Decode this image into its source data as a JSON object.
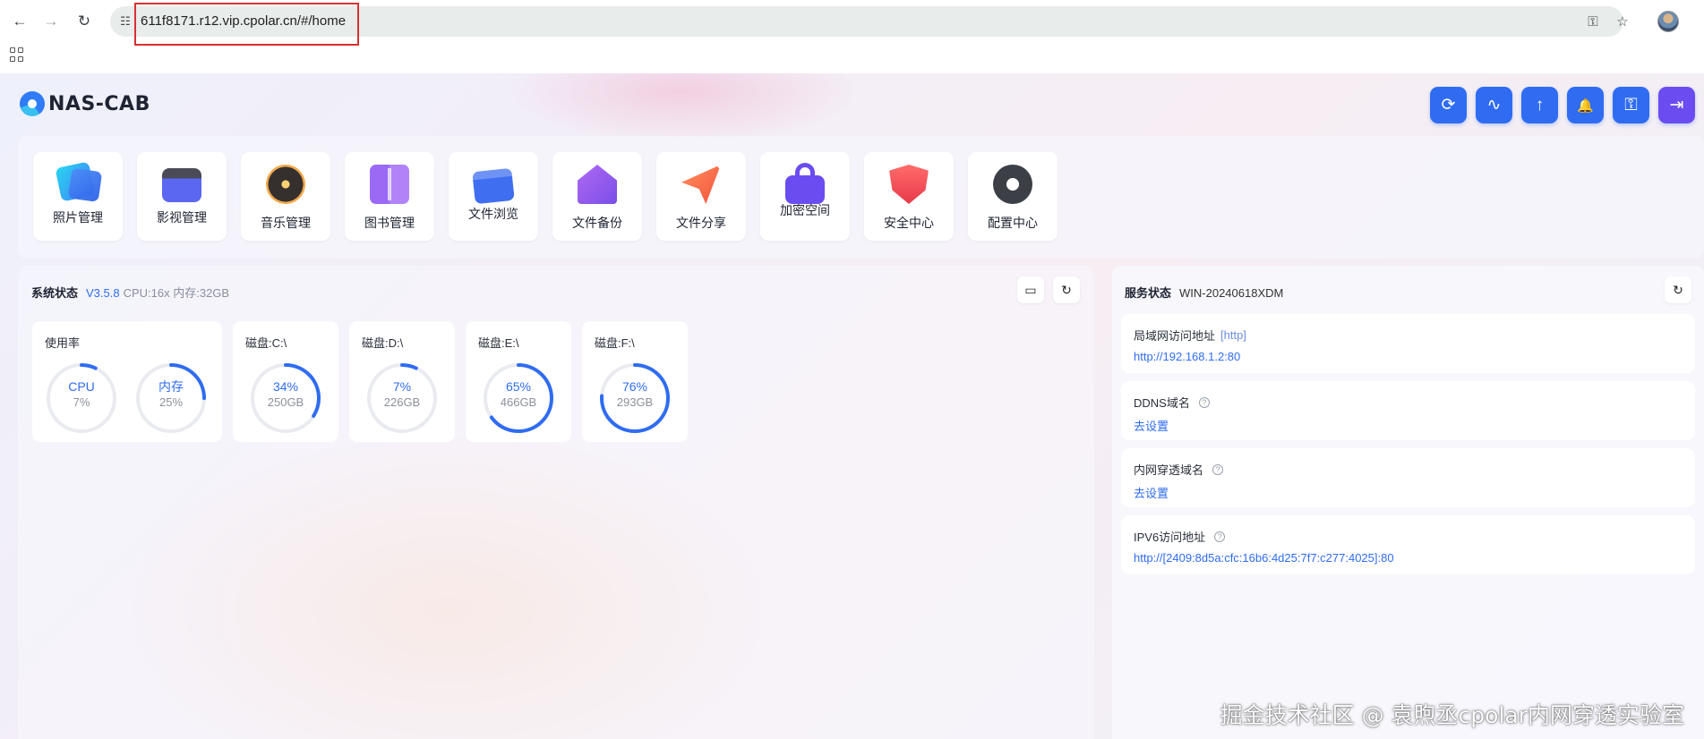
{
  "browser": {
    "url": "611f8171.r12.vip.cpolar.cn/#/home"
  },
  "app": {
    "logo_text": "NAS-CAB",
    "top_actions": [
      {
        "icon": "refresh-icon",
        "glyph": "⟳"
      },
      {
        "icon": "activity-icon",
        "glyph": "∿"
      },
      {
        "icon": "upload-arrow-icon",
        "glyph": "↑"
      },
      {
        "icon": "bell-icon",
        "glyph": "🔔"
      },
      {
        "icon": "key-icon",
        "glyph": "⚿"
      },
      {
        "icon": "logout-icon",
        "glyph": "⇥"
      }
    ],
    "tiles": [
      {
        "label": "照片管理",
        "icon": "photo-icon"
      },
      {
        "label": "影视管理",
        "icon": "video-icon"
      },
      {
        "label": "音乐管理",
        "icon": "music-icon"
      },
      {
        "label": "图书管理",
        "icon": "book-icon"
      },
      {
        "label": "文件浏览",
        "icon": "folder-icon"
      },
      {
        "label": "文件备份",
        "icon": "backup-icon"
      },
      {
        "label": "文件分享",
        "icon": "share-icon"
      },
      {
        "label": "加密空间",
        "icon": "lock-icon"
      },
      {
        "label": "安全中心",
        "icon": "shield-icon"
      },
      {
        "label": "配置中心",
        "icon": "gear-icon"
      }
    ]
  },
  "system": {
    "title": "系统状态",
    "version": "V3.5.8",
    "meta": "CPU:16x 内存:32GB",
    "usage_title": "使用率",
    "cpu": {
      "label": "CPU",
      "value": "7%",
      "fraction": 0.07
    },
    "mem": {
      "label": "内存",
      "value": "25%",
      "fraction": 0.25
    },
    "disks": [
      {
        "title": "磁盘:C:\\",
        "percent": "34%",
        "size": "250GB",
        "fraction": 0.34
      },
      {
        "title": "磁盘:D:\\",
        "percent": "7%",
        "size": "226GB",
        "fraction": 0.07
      },
      {
        "title": "磁盘:E:\\",
        "percent": "65%",
        "size": "466GB",
        "fraction": 0.65
      },
      {
        "title": "磁盘:F:\\",
        "percent": "76%",
        "size": "293GB",
        "fraction": 0.76
      }
    ]
  },
  "service": {
    "title": "服务状态",
    "host": "WIN-20240618XDM",
    "items": [
      {
        "label": "局域网访问地址",
        "tag": "[http]",
        "value": "http://192.168.1.2:80",
        "help": false
      },
      {
        "label": "DDNS域名",
        "tag": "",
        "value": "去设置",
        "help": true
      },
      {
        "label": "内网穿透域名",
        "tag": "",
        "value": "去设置",
        "help": true
      },
      {
        "label": "IPV6访问地址",
        "tag": "",
        "value": "http://[2409:8d5a:cfc:16b6:4d25:7f7:c277:4025]:80",
        "help": true
      }
    ]
  },
  "watermark": "掘金技术社区 @ 袁煦丞cpolar内网穿透实验室",
  "colors": {
    "accent": "#2f6cf2",
    "accent_purple": "#6a4cf0",
    "ring_track": "#e9ebf0"
  }
}
